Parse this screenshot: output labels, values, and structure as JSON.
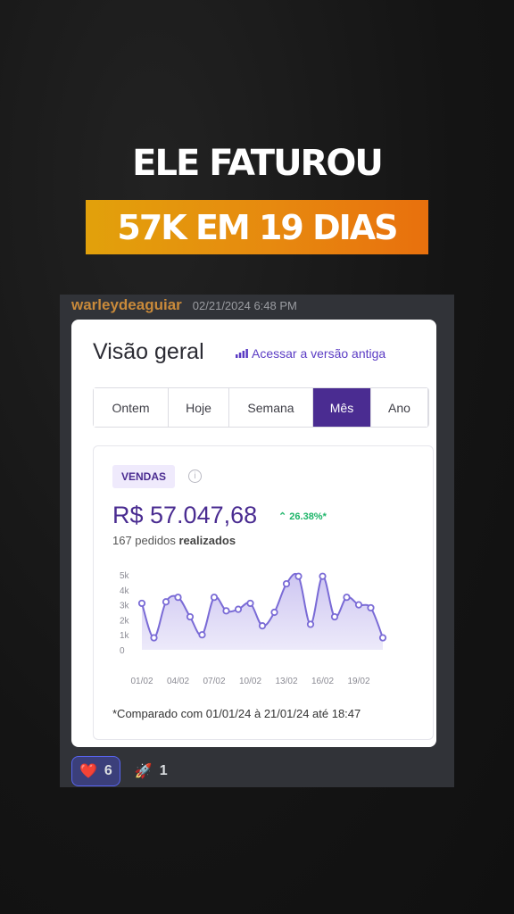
{
  "headline": {
    "line1": "ELE FATUROU",
    "line2": "57K EM 19 DIAS"
  },
  "message": {
    "username": "warleydeaguiar",
    "timestamp": "02/21/2024 6:48 PM"
  },
  "card": {
    "title": "Visão geral",
    "old_version_link": "Acessar a versão antiga",
    "tabs": [
      "Ontem",
      "Hoje",
      "Semana",
      "Mês",
      "Ano"
    ],
    "active_tab": "Mês",
    "badge": "VENDAS",
    "amount": "R$ 57.047,68",
    "growth": "26.38%*",
    "orders_count": "167 pedidos",
    "orders_suffix": "realizados",
    "footnote": "*Comparado com 01/01/24 à 21/01/24 até 18:47"
  },
  "chart_data": {
    "type": "area",
    "y_ticks": [
      "0",
      "1k",
      "2k",
      "3k",
      "4k",
      "5k"
    ],
    "x_ticks": [
      "01/02",
      "04/02",
      "07/02",
      "10/02",
      "13/02",
      "16/02",
      "19/02"
    ],
    "ylim": [
      0,
      5000
    ],
    "x": [
      "01/02",
      "02/02",
      "03/02",
      "04/02",
      "05/02",
      "06/02",
      "07/02",
      "08/02",
      "09/02",
      "10/02",
      "11/02",
      "12/02",
      "13/02",
      "14/02",
      "15/02",
      "16/02",
      "17/02",
      "18/02",
      "19/02",
      "20/02",
      "21/02"
    ],
    "values": [
      3100,
      800,
      3200,
      3500,
      2200,
      1000,
      3500,
      2600,
      2700,
      3100,
      1600,
      2500,
      4400,
      4900,
      1700,
      4900,
      2200,
      3500,
      3000,
      2800,
      800
    ],
    "colors": {
      "line": "#7a6bd6",
      "fill": "#cbc3f1"
    }
  },
  "reactions": [
    {
      "icon": "heart-icon",
      "emoji": "❤️",
      "count": "6"
    },
    {
      "icon": "rocket-icon",
      "emoji": "🚀",
      "count": "1"
    }
  ]
}
